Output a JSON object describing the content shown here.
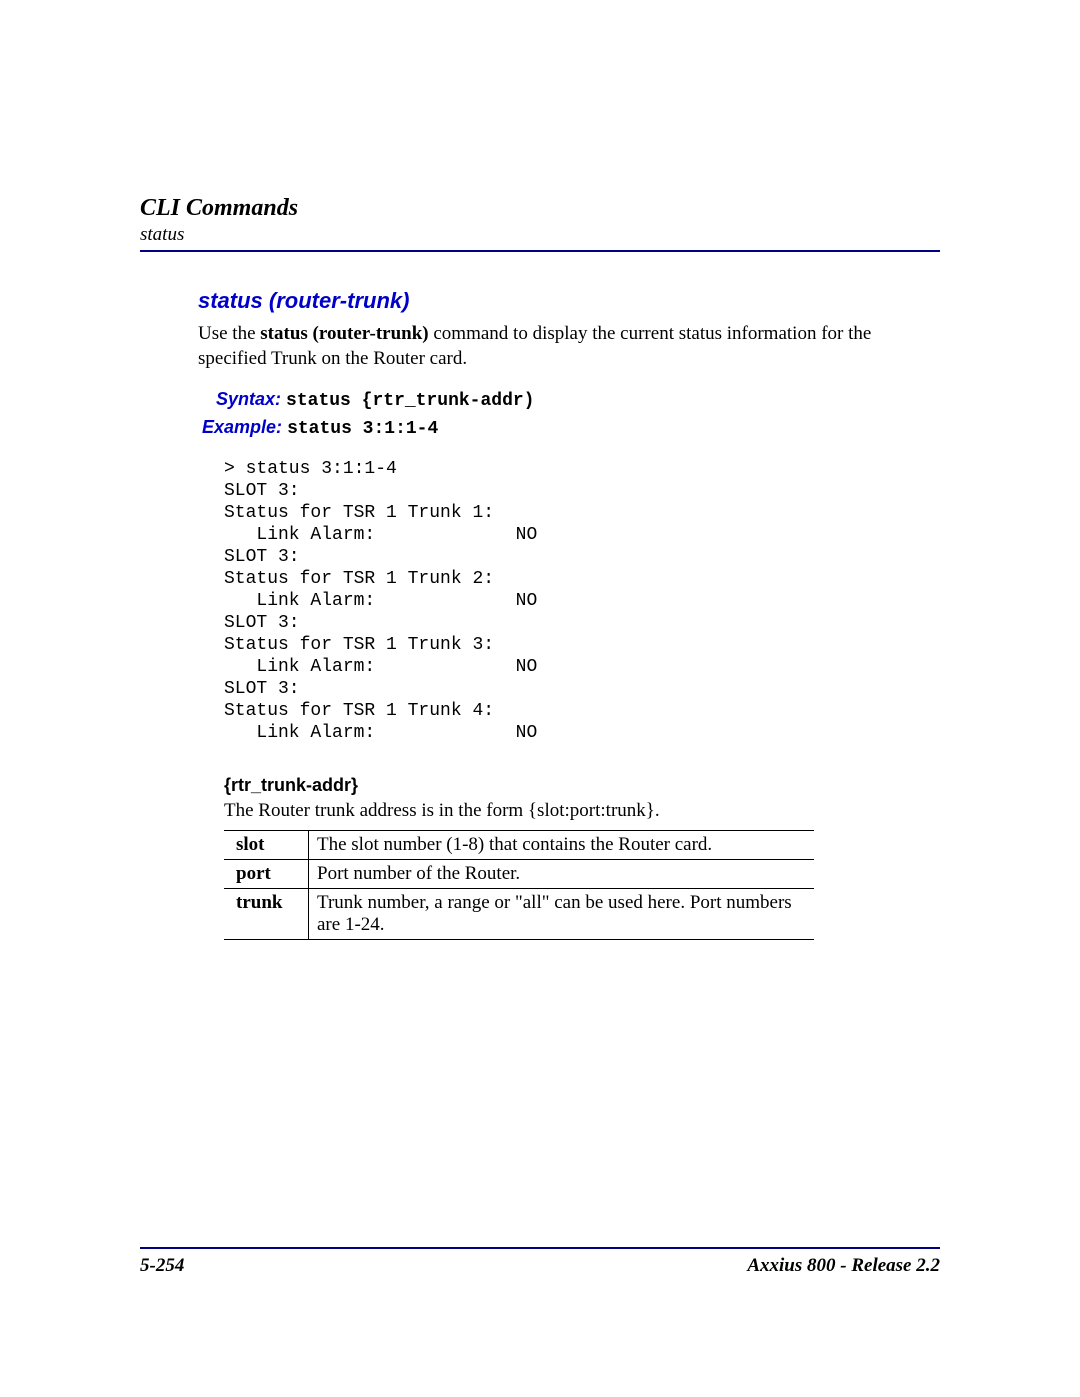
{
  "header": {
    "chapter": "CLI Commands",
    "section": "status"
  },
  "command": {
    "title": "status (router-trunk)",
    "description_pre": "Use the ",
    "description_bold": "status (router-trunk)",
    "description_post": " command to display the current status information for the specified Trunk on the Router card.",
    "syntax_label": "Syntax:",
    "syntax_value": "status {rtr_trunk-addr)",
    "example_label": "Example:",
    "example_value": "status 3:1:1-4",
    "console": "> status 3:1:1-4\nSLOT 3:\nStatus for TSR 1 Trunk 1:\n   Link Alarm:             NO\nSLOT 3:\nStatus for TSR 1 Trunk 2:\n   Link Alarm:             NO\nSLOT 3:\nStatus for TSR 1 Trunk 3:\n   Link Alarm:             NO\nSLOT 3:\nStatus for TSR 1 Trunk 4:\n   Link Alarm:             NO"
  },
  "params": {
    "heading": "{rtr_trunk-addr}",
    "desc": "The Router trunk address is in the form {slot:port:trunk}.",
    "rows": [
      {
        "key": "slot",
        "val": "The slot number (1-8) that contains the Router card."
      },
      {
        "key": "port",
        "val": "Port number of the Router."
      },
      {
        "key": "trunk",
        "val": "Trunk number, a range or \"all\" can be used here. Port numbers are 1-24."
      }
    ]
  },
  "footer": {
    "page": "5-254",
    "product": "Axxius 800 - Release 2.2"
  }
}
